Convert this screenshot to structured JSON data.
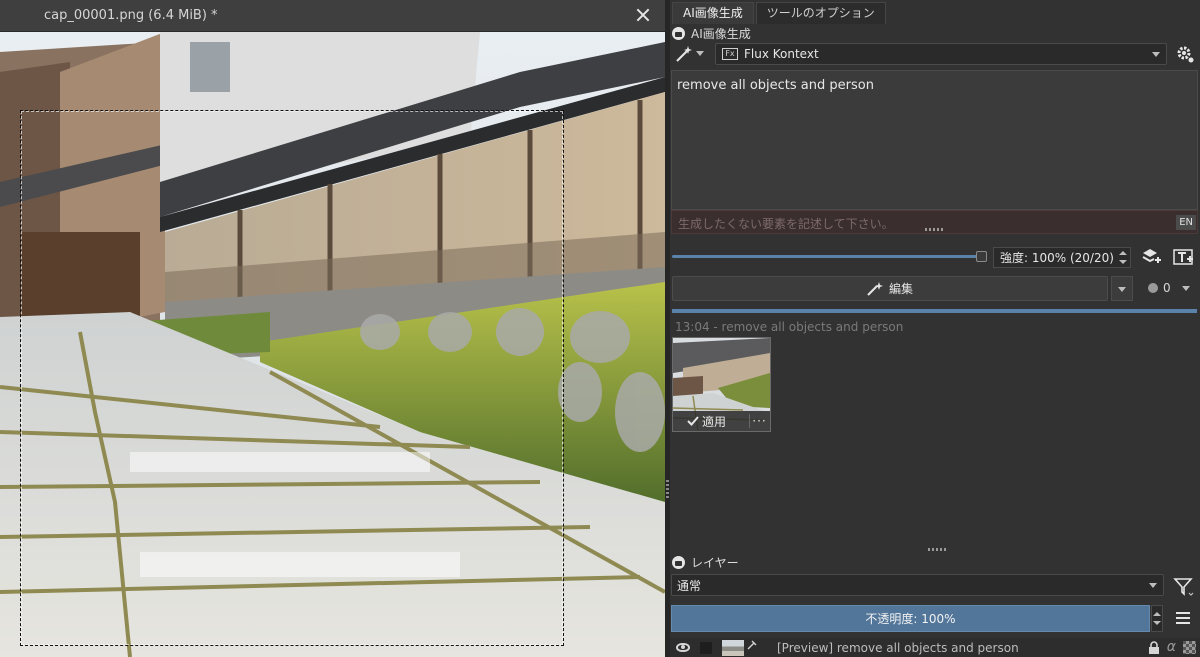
{
  "document": {
    "title": "cap_00001.png (6.4 MiB) *"
  },
  "dock": {
    "tabs": [
      {
        "label": "AI画像生成",
        "active": true
      },
      {
        "label": "ツールのオプション",
        "active": false
      }
    ],
    "ai_panel": {
      "title": "AI画像生成",
      "model": "Flux Kontext",
      "prompt": "remove all objects and person",
      "negative_placeholder": "生成したくない要素を記述して下さい。",
      "language_badge": "EN",
      "strength": {
        "label": "強度: 100% (20/20)",
        "value_percent": 100
      },
      "edit_button": "編集",
      "queue_count": "0",
      "progress_percent": 100,
      "history": {
        "label": "13:04 - remove all objects and person",
        "apply_label": "適用",
        "more_label": "···"
      }
    },
    "layers_panel": {
      "title": "レイヤー",
      "blend_mode": "通常",
      "opacity_label": "不透明度:  100%",
      "layer_name": "[Preview] remove all objects and person"
    }
  },
  "colors": {
    "accent": "#5b82a8",
    "negative_bg": "#3a2e2e",
    "opacity_bar": "#52769a"
  }
}
